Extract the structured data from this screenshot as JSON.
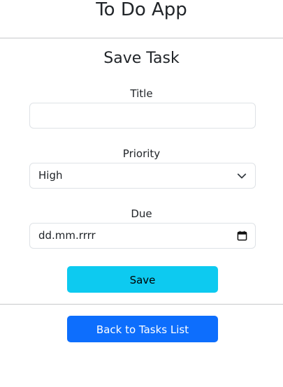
{
  "app": {
    "title": "To Do App"
  },
  "form": {
    "title": "Save Task",
    "fields": {
      "title": {
        "label": "Title",
        "value": "",
        "placeholder": ""
      },
      "priority": {
        "label": "Priority",
        "selected": "High"
      },
      "due": {
        "label": "Due",
        "value": "dd.mm.rrrr"
      }
    },
    "save_label": "Save"
  },
  "nav": {
    "back_label": "Back to Tasks List"
  },
  "icons": {
    "priority_dropdown": "chevron-down-icon",
    "due_picker": "calendar-icon"
  },
  "colors": {
    "save_button": "#0dcaf0",
    "back_button": "#0d6efd"
  }
}
